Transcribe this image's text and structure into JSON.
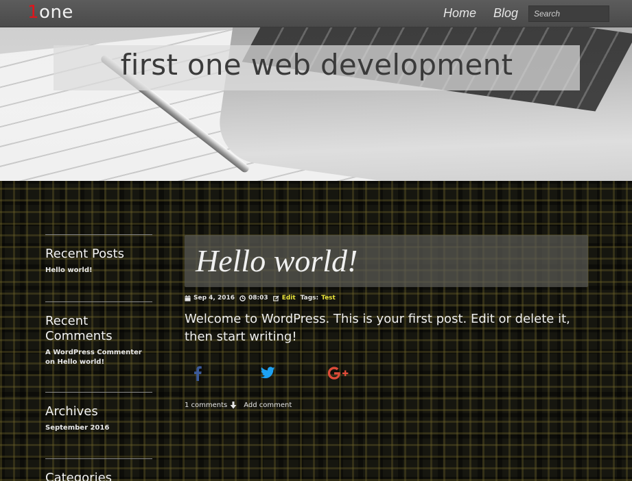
{
  "nav": {
    "brand_digit": "1",
    "brand_text": "one",
    "links": [
      "Home",
      "Blog"
    ],
    "search_placeholder": "Search"
  },
  "hero": {
    "title": "first one web development"
  },
  "sidebar": {
    "recent_posts": {
      "title": "Recent Posts",
      "items": [
        "Hello world!"
      ]
    },
    "recent_comments": {
      "title": "Recent Comments",
      "author": "A WordPress Commenter",
      "on_word": "on",
      "post": "Hello world!"
    },
    "archives": {
      "title": "Archives",
      "items": [
        "September 2016"
      ]
    },
    "categories": {
      "title": "Categories"
    }
  },
  "post": {
    "title": "Hello world!",
    "date": "Sep 4, 2016",
    "time": "08:03",
    "edit_label": "Edit",
    "tags_label": "Tags:",
    "tag": "Test",
    "body": "Welcome to WordPress. This is your first post. Edit or delete it, then start writing!",
    "comments_count": "1 comments",
    "add_comment": "Add comment"
  },
  "colors": {
    "brand_red": "#e0141b",
    "tag_yellow": "#e8e23a",
    "facebook": "#3b5998",
    "twitter": "#1da1f2",
    "google_plus": "#dd4b39"
  },
  "icons": [
    "calendar-icon",
    "clock-icon",
    "edit-icon",
    "facebook-icon",
    "twitter-icon",
    "google-plus-icon",
    "arrow-down-icon"
  ]
}
